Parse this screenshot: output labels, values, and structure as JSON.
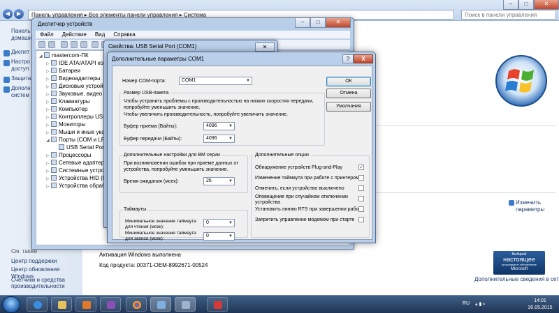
{
  "control_panel": {
    "address": [
      "Панель управления",
      "Все элементы панели управления",
      "Система"
    ],
    "search_placeholder": "Поиск в панели управления",
    "left_links": [
      "Панель",
      "домашн",
      "Диспет",
      "Настро",
      "доступ",
      "Защита",
      "Дополн",
      "систем"
    ],
    "see_also": "См. также",
    "bottom_links": [
      "Центр поддержки",
      "Центр обновления Windows",
      "Счетчики и средства",
      "производительности"
    ],
    "change_params_1": "Изменить",
    "change_params_2": "параметры",
    "activation": "Активация Windows выполнена",
    "product_id": "Код продукта: 00371-OEM-8992671-00524",
    "genuine_1": "Выбирай",
    "genuine_2": "настоящее",
    "genuine_3": "программное обеспечение",
    "genuine_4": "Microsoft",
    "more_info": "Дополнительные сведения в сети..."
  },
  "device_manager": {
    "title": "Диспетчер устройств",
    "menu": [
      "Файл",
      "Действие",
      "Вид",
      "Справка"
    ],
    "tree": [
      "mastercom-ПК",
      "IDE ATA/ATAPI контр",
      "Батареи",
      "Видеоадаптеры",
      "Дисковые устройст",
      "Звуковые, видео и и",
      "Клавиатуры",
      "Компьютер",
      "Контроллеры USB",
      "Мониторы",
      "Мыши и иные указы",
      "Порты (COM и LPT)",
      "USB Serial Port (C",
      "Процессоры",
      "Сетевые адаптеры",
      "Системные устройс",
      "Устройства HID (Hum",
      "Устройства обработ"
    ]
  },
  "properties": {
    "title": "Свойства: USB Serial Port (COM1)"
  },
  "advanced": {
    "title": "Дополнительные параметры COM1",
    "help": "?",
    "close": "X",
    "com_port_label": "Номер COM-порта:",
    "com_port_value": "COM1",
    "usb_group": "Размер USB-пакета",
    "usb_hint_1": "Чтобы устранить проблемы с производительностью на низких скоростях передачи,",
    "usb_hint_2": "попробуйте уменьшить значение.",
    "usb_hint_3": "Чтобы увеличить производительность, попробуйте увеличить значение.",
    "rx_label": "Буфер приема (Байты):",
    "rx_value": "4096",
    "tx_label": "Буфер передачи (Байты):",
    "tx_value": "4096",
    "bm_group": "Дополнительные настройки для ВМ серии",
    "bm_hint_1": "При возникновении ошибок при приеме данных от",
    "bm_hint_2": "устройства, попробуйте уменьшить значение.",
    "latency_label": "Время ожидания (мсек):",
    "latency_value": "26",
    "timeouts_group": "Таймауты",
    "read_label_1": "Минимальное значение таймаута",
    "read_label_2": "для чтения (мсек):",
    "read_value": "0",
    "write_label_1": "Минимальное значение таймаута",
    "write_label_2": "для записи (мсек):",
    "write_value": "0",
    "options_group": "Дополнительные опции",
    "options": [
      "Обнаружение устройств Plug-and-Play",
      "Изменение таймаута при работе с принтером",
      "Отменить, если устройство выключено",
      "Оповещение при случайном отключении",
      "Установить линию RTS при завершении работы",
      "Запретить управление модемом при старте"
    ],
    "option4_line2": "устройства",
    "options_checked": [
      true,
      false,
      false,
      false,
      false,
      false
    ],
    "ok": "ОК",
    "cancel": "Отмена",
    "defaults": "Умолчания"
  },
  "taskbar": {
    "lang": "RU",
    "time": "14:01",
    "date": "30.05.2015"
  }
}
